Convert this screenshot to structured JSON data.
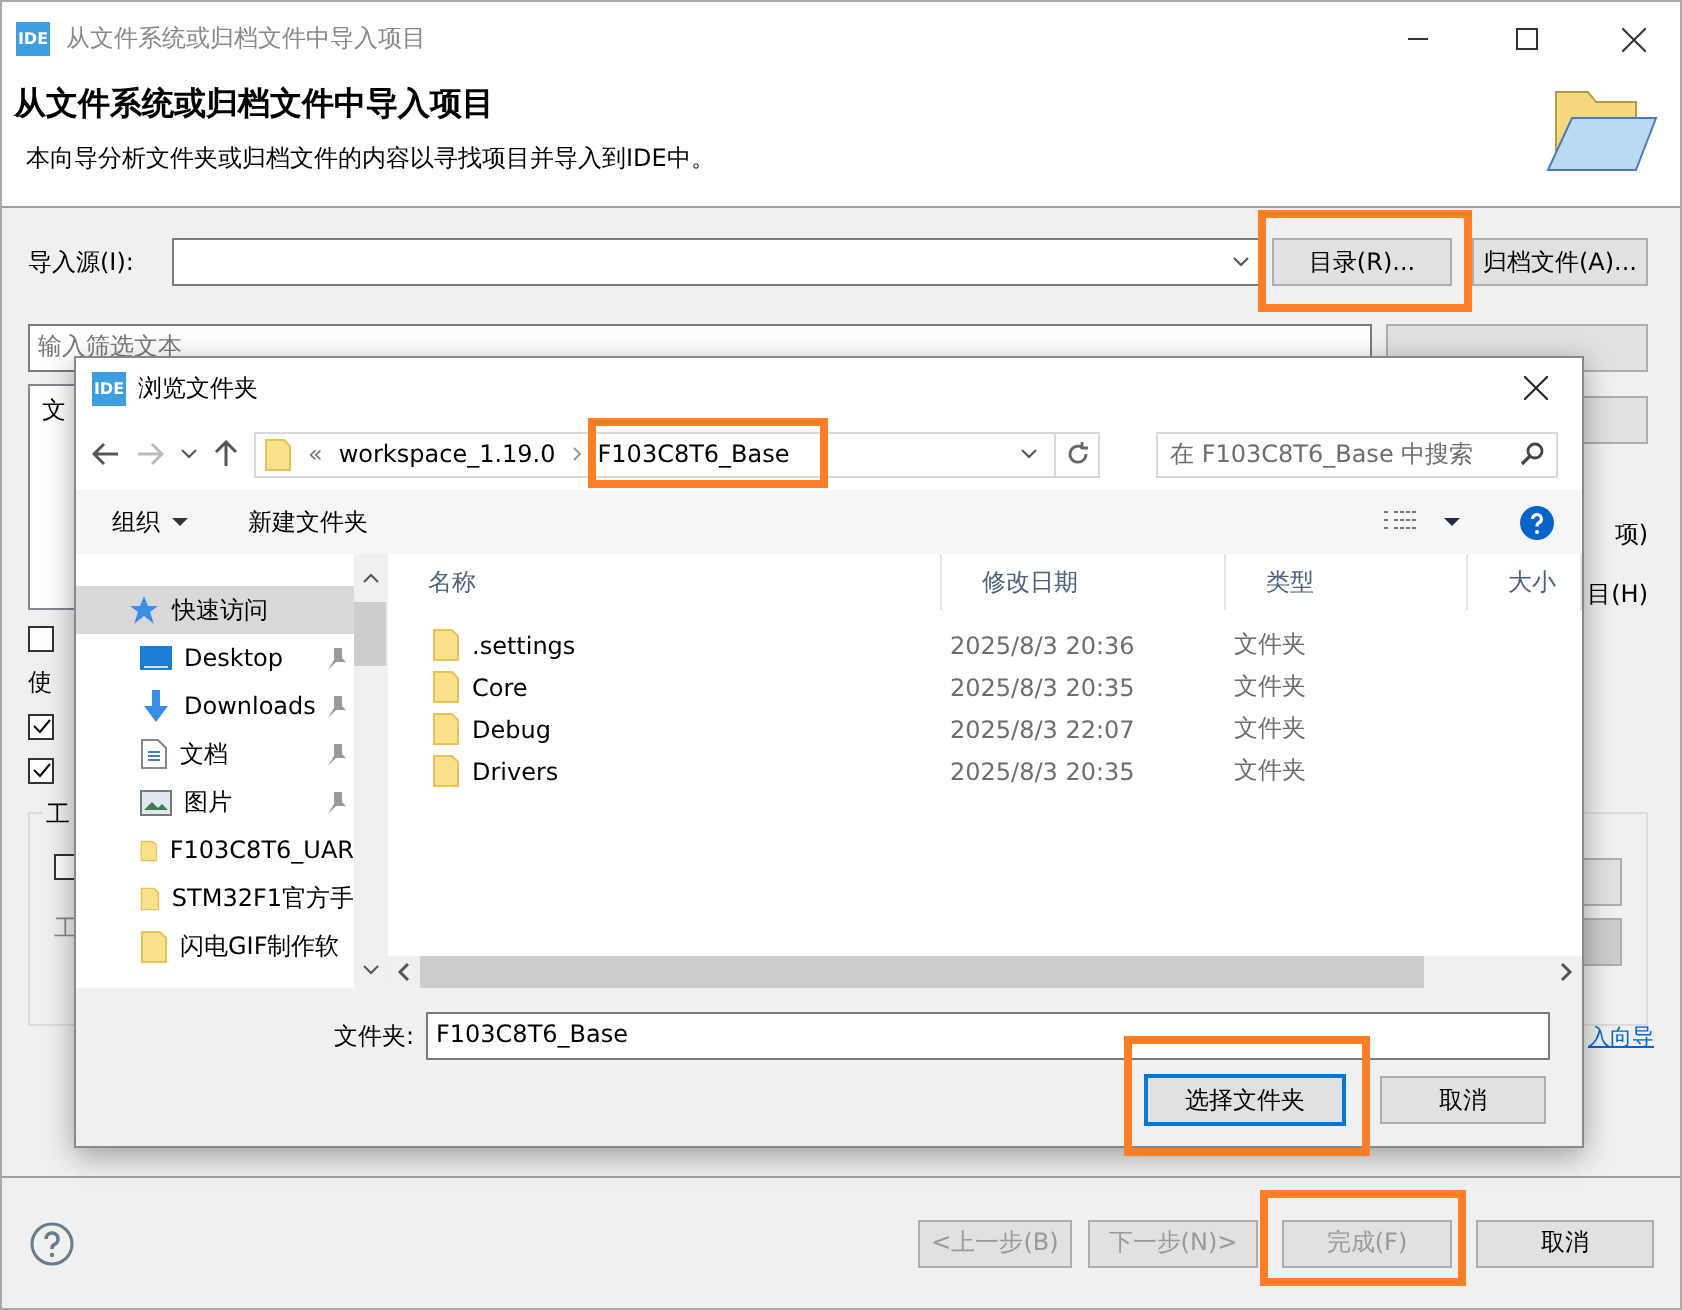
{
  "window": {
    "title": "从文件系统或归档文件中导入项目",
    "icon": "IDE"
  },
  "header": {
    "title": "从文件系统或归档文件中导入项目",
    "description": "本向导分析文件夹或归档文件的内容以寻找项目并导入到IDE中。"
  },
  "source": {
    "label": "导入源(I):",
    "buttons": [
      "目录(R)...",
      "归档文件(A)..."
    ]
  },
  "filter": {
    "placeholder": "输入筛选文本"
  },
  "list_fragment": "文",
  "right_labels": [
    "项)",
    "目(H)"
  ],
  "options": [
    {
      "kind": "checkbox",
      "checked": false
    },
    {
      "kind": "text",
      "label": "使"
    },
    {
      "kind": "checkbox",
      "checked": true
    },
    {
      "kind": "checkbox",
      "checked": true
    }
  ],
  "group": {
    "legend": "工",
    "checked": false,
    "disabled_label": "工"
  },
  "link_fragment": "入向导",
  "footer_buttons": [
    {
      "label": "<上一步(B)",
      "disabled": true
    },
    {
      "label": "下一步(N)>",
      "disabled": true
    },
    {
      "label": "完成(F)",
      "disabled": true
    },
    {
      "label": "取消",
      "disabled": false
    }
  ],
  "dialog": {
    "title": "浏览文件夹",
    "icon": "IDE",
    "overflow": "«",
    "breadcrumb": [
      "workspace_1.19.0",
      "F103C8T6_Base"
    ],
    "search": {
      "placeholder": "在 F103C8T6_Base 中搜索"
    },
    "toolbar": {
      "organize": "组织",
      "new_folder": "新建文件夹"
    },
    "nav": [
      {
        "label": "快速访问",
        "kind": "star",
        "pinned": false,
        "selected": true
      },
      {
        "label": "Desktop",
        "kind": "desktop",
        "pinned": true,
        "selected": false
      },
      {
        "label": "Downloads",
        "kind": "download",
        "pinned": true,
        "selected": false
      },
      {
        "label": "文档",
        "kind": "document",
        "pinned": true,
        "selected": false
      },
      {
        "label": "图片",
        "kind": "picture",
        "pinned": true,
        "selected": false
      },
      {
        "label": "F103C8T6_UAR",
        "kind": "folder",
        "pinned": false,
        "selected": false
      },
      {
        "label": "STM32F1官方手",
        "kind": "folder",
        "pinned": false,
        "selected": false
      },
      {
        "label": "闪电GIF制作软",
        "kind": "folder",
        "pinned": false,
        "selected": false
      }
    ],
    "columns": [
      "名称",
      "修改日期",
      "类型",
      "大小"
    ],
    "rows": [
      {
        "name": ".settings",
        "modified": "2025/8/3 20:36",
        "type": "文件夹"
      },
      {
        "name": "Core",
        "modified": "2025/8/3 20:35",
        "type": "文件夹"
      },
      {
        "name": "Debug",
        "modified": "2025/8/3 22:07",
        "type": "文件夹"
      },
      {
        "name": "Drivers",
        "modified": "2025/8/3 20:35",
        "type": "文件夹"
      }
    ],
    "folder_label": "文件夹:",
    "folder_value": "F103C8T6_Base",
    "buttons": [
      {
        "label": "选择文件夹",
        "focused": true
      },
      {
        "label": "取消",
        "focused": false
      }
    ]
  }
}
